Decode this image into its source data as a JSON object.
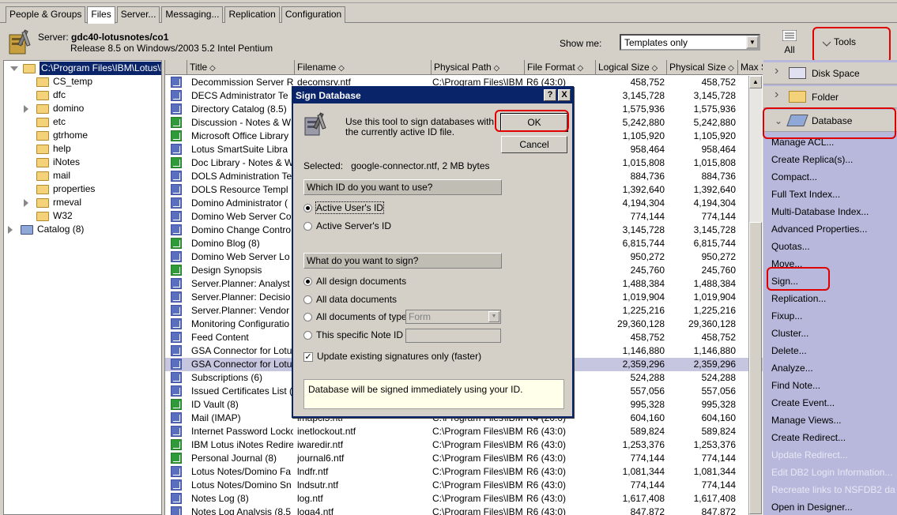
{
  "tabs": [
    {
      "label": "People & Groups",
      "active": false
    },
    {
      "label": "Files",
      "active": true
    },
    {
      "label": "Server...",
      "active": false
    },
    {
      "label": "Messaging...",
      "active": false
    },
    {
      "label": "Replication",
      "active": false
    },
    {
      "label": "Configuration",
      "active": false
    }
  ],
  "header": {
    "server_label": "Server:",
    "server_name": "gdc40-lotusnotes/co1",
    "release": "Release 8.5 on Windows/2003 5.2 Intel Pentium",
    "show_me_label": "Show me:",
    "show_me_value": "Templates only",
    "all_label": "All",
    "tools_label": "Tools"
  },
  "tree": {
    "root": "C:\\Program Files\\IBM\\Lotus\\Dor",
    "items": [
      "CS_temp",
      "dfc",
      "domino",
      "etc",
      "gtrhome",
      "help",
      "iNotes",
      "mail",
      "properties",
      "rmeval",
      "W32"
    ],
    "catalog": "Catalog (8)"
  },
  "columns": [
    "Title",
    "Filename",
    "Physical Path",
    "File Format",
    "Logical Size",
    "Physical Size",
    "Max S"
  ],
  "rows": [
    {
      "title": "Decommission Server R",
      "filename": "decomsrv.ntf",
      "path": "C:\\Program Files\\IBM",
      "format": "R6 (43:0)",
      "logical": "458,752",
      "physical": "458,752",
      "green": false
    },
    {
      "title": "DECS Administrator Te",
      "filename": "",
      "path": "",
      "format": "",
      "logical": "3,145,728",
      "physical": "3,145,728",
      "green": false
    },
    {
      "title": "Directory Catalog (8.5)",
      "filename": "",
      "path": "",
      "format": "",
      "logical": "1,575,936",
      "physical": "1,575,936",
      "green": false
    },
    {
      "title": "Discussion - Notes & W",
      "filename": "",
      "path": "",
      "format": "",
      "logical": "5,242,880",
      "physical": "5,242,880",
      "green": true
    },
    {
      "title": "Microsoft Office Library",
      "filename": "",
      "path": "",
      "format": "",
      "logical": "1,105,920",
      "physical": "1,105,920",
      "green": true
    },
    {
      "title": "Lotus SmartSuite Libra",
      "filename": "",
      "path": "",
      "format": "",
      "logical": "958,464",
      "physical": "958,464",
      "green": false
    },
    {
      "title": "Doc Library - Notes & W",
      "filename": "",
      "path": "",
      "format": "",
      "logical": "1,015,808",
      "physical": "1,015,808",
      "green": true
    },
    {
      "title": "DOLS Administration Te",
      "filename": "",
      "path": "",
      "format": "",
      "logical": "884,736",
      "physical": "884,736",
      "green": false
    },
    {
      "title": "DOLS Resource Templ",
      "filename": "",
      "path": "",
      "format": "",
      "logical": "1,392,640",
      "physical": "1,392,640",
      "green": false
    },
    {
      "title": "Domino Administrator (",
      "filename": "",
      "path": "",
      "format": "",
      "logical": "4,194,304",
      "physical": "4,194,304",
      "green": false
    },
    {
      "title": "Domino Web Server Co",
      "filename": "",
      "path": "",
      "format": "",
      "logical": "774,144",
      "physical": "774,144",
      "green": false
    },
    {
      "title": "Domino Change Contro",
      "filename": "",
      "path": "",
      "format": "",
      "logical": "3,145,728",
      "physical": "3,145,728",
      "green": false
    },
    {
      "title": "Domino Blog (8)",
      "filename": "",
      "path": "",
      "format": "",
      "logical": "6,815,744",
      "physical": "6,815,744",
      "green": true
    },
    {
      "title": "Domino Web Server Lo",
      "filename": "",
      "path": "",
      "format": "",
      "logical": "950,272",
      "physical": "950,272",
      "green": false
    },
    {
      "title": "Design Synopsis",
      "filename": "",
      "path": "",
      "format": "",
      "logical": "245,760",
      "physical": "245,760",
      "green": true
    },
    {
      "title": "Server.Planner: Analyst",
      "filename": "",
      "path": "",
      "format": "",
      "logical": "1,488,384",
      "physical": "1,488,384",
      "green": false
    },
    {
      "title": "Server.Planner: Decisio",
      "filename": "",
      "path": "",
      "format": "",
      "logical": "1,019,904",
      "physical": "1,019,904",
      "green": false
    },
    {
      "title": "Server.Planner: Vendor",
      "filename": "",
      "path": "",
      "format": "",
      "logical": "1,225,216",
      "physical": "1,225,216",
      "green": false
    },
    {
      "title": "Monitoring Configuratio",
      "filename": "",
      "path": "",
      "format": "",
      "logical": "29,360,128",
      "physical": "29,360,128",
      "green": false
    },
    {
      "title": "Feed Content",
      "filename": "",
      "path": "",
      "format": "",
      "logical": "458,752",
      "physical": "458,752",
      "green": false
    },
    {
      "title": "GSA Connector for Lotu",
      "filename": "",
      "path": "",
      "format": "",
      "logical": "1,146,880",
      "physical": "1,146,880",
      "green": false
    },
    {
      "title": "GSA Connector for Lotu",
      "filename": "",
      "path": "",
      "format": "",
      "logical": "2,359,296",
      "physical": "2,359,296",
      "green": false,
      "selected": true
    },
    {
      "title": "Subscriptions (6)",
      "filename": "",
      "path": "",
      "format": "",
      "logical": "524,288",
      "physical": "524,288",
      "green": false
    },
    {
      "title": "Issued Certificates List (",
      "filename": "",
      "path": "",
      "format": "",
      "logical": "557,056",
      "physical": "557,056",
      "green": false
    },
    {
      "title": "ID Vault (8)",
      "filename": "",
      "path": "",
      "format": "",
      "logical": "995,328",
      "physical": "995,328",
      "green": true
    },
    {
      "title": "Mail (IMAP)",
      "filename": "imapcl5.ntf",
      "path": "C:\\Program Files\\IBM",
      "format": "R4 (20:0)",
      "logical": "604,160",
      "physical": "604,160",
      "green": false
    },
    {
      "title": "Internet Password Locko",
      "filename": "inetlockout.ntf",
      "path": "C:\\Program Files\\IBM",
      "format": "R6 (43:0)",
      "logical": "589,824",
      "physical": "589,824",
      "green": false
    },
    {
      "title": "IBM Lotus iNotes Redire",
      "filename": "iwaredir.ntf",
      "path": "C:\\Program Files\\IBM",
      "format": "R6 (43:0)",
      "logical": "1,253,376",
      "physical": "1,253,376",
      "green": true
    },
    {
      "title": "Personal Journal (8)",
      "filename": "journal6.ntf",
      "path": "C:\\Program Files\\IBM",
      "format": "R6 (43:0)",
      "logical": "774,144",
      "physical": "774,144",
      "green": true
    },
    {
      "title": "Lotus Notes/Domino Fa",
      "filename": "lndfr.ntf",
      "path": "C:\\Program Files\\IBM",
      "format": "R6 (43:0)",
      "logical": "1,081,344",
      "physical": "1,081,344",
      "green": false
    },
    {
      "title": "Lotus Notes/Domino Sn",
      "filename": "lndsutr.ntf",
      "path": "C:\\Program Files\\IBM",
      "format": "R6 (43:0)",
      "logical": "774,144",
      "physical": "774,144",
      "green": false
    },
    {
      "title": "Notes Log (8)",
      "filename": "log.ntf",
      "path": "C:\\Program Files\\IBM",
      "format": "R6 (43:0)",
      "logical": "1,617,408",
      "physical": "1,617,408",
      "green": false
    },
    {
      "title": "Notes Log Analysis (8.5",
      "filename": "loga4.ntf",
      "path": "C:\\Program Files\\IBM",
      "format": "R6 (43:0)",
      "logical": "847,872",
      "physical": "847,872",
      "green": false
    }
  ],
  "tools_panel": {
    "sections": [
      "Disk Space",
      "Folder",
      "Database"
    ],
    "items": [
      {
        "label": "Manage ACL...",
        "enabled": true
      },
      {
        "label": "Create Replica(s)...",
        "enabled": true
      },
      {
        "label": "Compact...",
        "enabled": true
      },
      {
        "label": "Full Text Index...",
        "enabled": true
      },
      {
        "label": "Multi-Database Index...",
        "enabled": true
      },
      {
        "label": "Advanced Properties...",
        "enabled": true
      },
      {
        "label": "Quotas...",
        "enabled": true
      },
      {
        "label": "Move...",
        "enabled": true
      },
      {
        "label": "Sign...",
        "enabled": true
      },
      {
        "label": "Replication...",
        "enabled": true
      },
      {
        "label": "Fixup...",
        "enabled": true
      },
      {
        "label": "Cluster...",
        "enabled": true
      },
      {
        "label": "Delete...",
        "enabled": true
      },
      {
        "label": "Analyze...",
        "enabled": true
      },
      {
        "label": "Find Note...",
        "enabled": true
      },
      {
        "label": "Create Event...",
        "enabled": true
      },
      {
        "label": "Manage Views...",
        "enabled": true
      },
      {
        "label": "Create Redirect...",
        "enabled": true
      },
      {
        "label": "Update Redirect...",
        "enabled": false
      },
      {
        "label": "Edit DB2 Login Information...",
        "enabled": false
      },
      {
        "label": "Recreate links to NSFDB2 da",
        "enabled": false
      },
      {
        "label": "Open in Designer...",
        "enabled": true
      }
    ]
  },
  "dialog": {
    "title": "Sign Database",
    "help": "?",
    "close": "X",
    "intro": "Use this tool to sign databases with the currently active ID file.",
    "ok": "OK",
    "cancel": "Cancel",
    "selected_label": "Selected:",
    "selected_value": "google-connector.ntf, 2 MB bytes",
    "which_id_heading": "Which ID do you want to use?",
    "id_options": [
      "Active User's ID",
      "Active Server's ID"
    ],
    "what_sign_heading": "What do you want to sign?",
    "sign_options": [
      "All design documents",
      "All data documents",
      "All documents of type",
      "This specific Note ID"
    ],
    "doc_type_value": "Form",
    "update_existing": "Update existing signatures only (faster)",
    "info": "Database will be signed immediately using your ID."
  }
}
